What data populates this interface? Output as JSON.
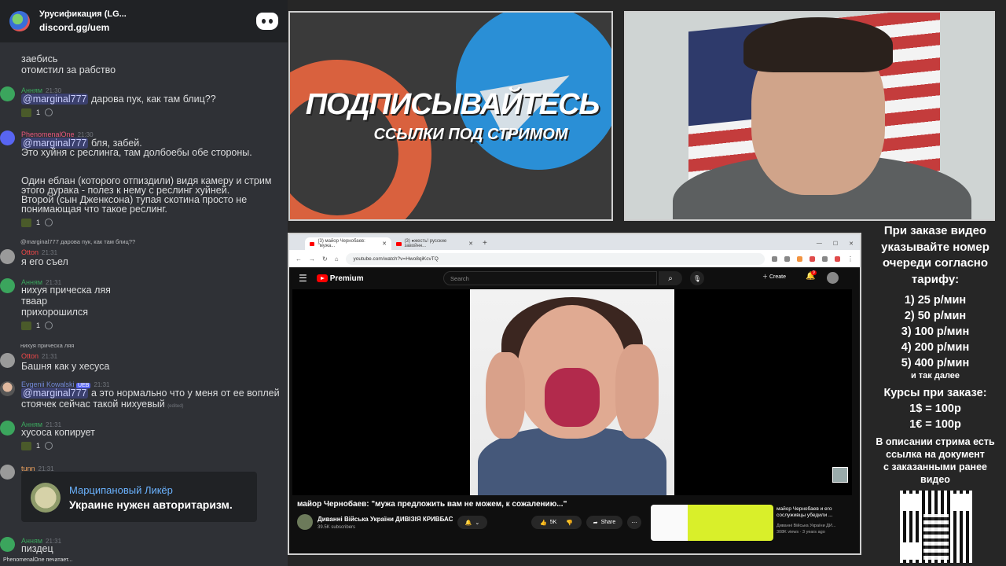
{
  "discord": {
    "server_name": "Урусификация (LG...",
    "invite": "discord.gg/uem",
    "top_lines": [
      "заебись",
      "отомстил за рабство"
    ],
    "m1": {
      "user": "Анням",
      "time": "21:30",
      "mention": "@marginal777",
      "text": " дарова пук, как там блиц??",
      "count": "1"
    },
    "m2": {
      "user": "PhenomenalOne",
      "time": "21:30",
      "mention": "@marginal777",
      "line1": " бля, забей.",
      "line2": "Это хуйня с реслинга, там долбоебы обе стороны.",
      "para": [
        "Один еблан (которого отпиздили) видя камеру и стрим",
        "этого дурака - полез к нему с реслинг хуйней.",
        "Второй (сын Дженксона) тупая скотина просто не",
        "понимающая что такое реслинг."
      ],
      "count": "1"
    },
    "reply1": "@marginal777 дарова пук, как там блиц??",
    "m3": {
      "user": "Otton",
      "time": "21:31",
      "text": "я его съел"
    },
    "m4": {
      "user": "Анням",
      "time": "21:31",
      "lines": [
        "нихуя прическа ляя",
        "тваар",
        "прихорошился"
      ],
      "count": "1"
    },
    "reply2": "нихуя прическа ляя",
    "m5": {
      "user": "Otton",
      "time": "21:31",
      "text": "Башня как у хесуса"
    },
    "m6": {
      "user": "Evgenii Kowalski",
      "badge": "UEB",
      "time": "21:31",
      "mention": "@marginal777",
      "line1": " а это нормально что у меня от ее воплей",
      "line2": "стоячек сейчас такой нихуевый",
      "edited": "(edited)"
    },
    "m7": {
      "user": "Анням",
      "time": "21:31",
      "text": "хусоса копирует",
      "count": "1"
    },
    "m8": {
      "user": "tunn",
      "time": "21:31"
    },
    "embed": {
      "title": "Марципановый Ликёр",
      "text": "Украине нужен авторитаризм."
    },
    "m9": {
      "user": "Анням",
      "time": "21:31",
      "text": "пиздец"
    },
    "typing": "PhenomenalOne печатает..."
  },
  "banner": {
    "line1": "ПОДПИСЫВАЙТЕСЬ",
    "line2": "ССЫЛКИ ПОД СТРИМОМ"
  },
  "browser": {
    "tab1": "(3) майор Чернобаев: \"мужа...",
    "tab2": "(3) ●жесть! русские завойнн...",
    "url": "youtube.com/watch?v=Hwo8qiKcvTQ",
    "brand": "Premium",
    "search_placeholder": "Search",
    "create": "Create",
    "notifications": "9",
    "video_title": "майор Чернобаев: \"мужа предложить вам не можем, к сожалению...\"",
    "channel": "Диванні Війська України ДИВІЗІЯ КРИВБАС",
    "subs": "39.5K subscribers",
    "likes": "5K",
    "share": "Share",
    "side_title": "майор Чернобаев и его сослуживцы убедили ...",
    "side_meta": "Диванні Війська України ДИ...",
    "side_meta2": "308K views · 3 years ago"
  },
  "info": {
    "head": [
      "При заказе видео",
      "указывайте номер",
      "очереди согласно",
      "тарифу:"
    ],
    "tariffs": [
      "1) 25 р/мин",
      "2) 50 р/мин",
      "3) 100 р/мин",
      "4) 200 р/мин",
      "5) 400 р/мин"
    ],
    "etc": "и так далее",
    "rates_head": "Курсы при заказе:",
    "rates": [
      "1$ = 100р",
      "1€ = 100р"
    ],
    "desc": [
      "В описании стрима есть",
      "ссылка на документ",
      "с заказанными ранее",
      "видео"
    ]
  }
}
